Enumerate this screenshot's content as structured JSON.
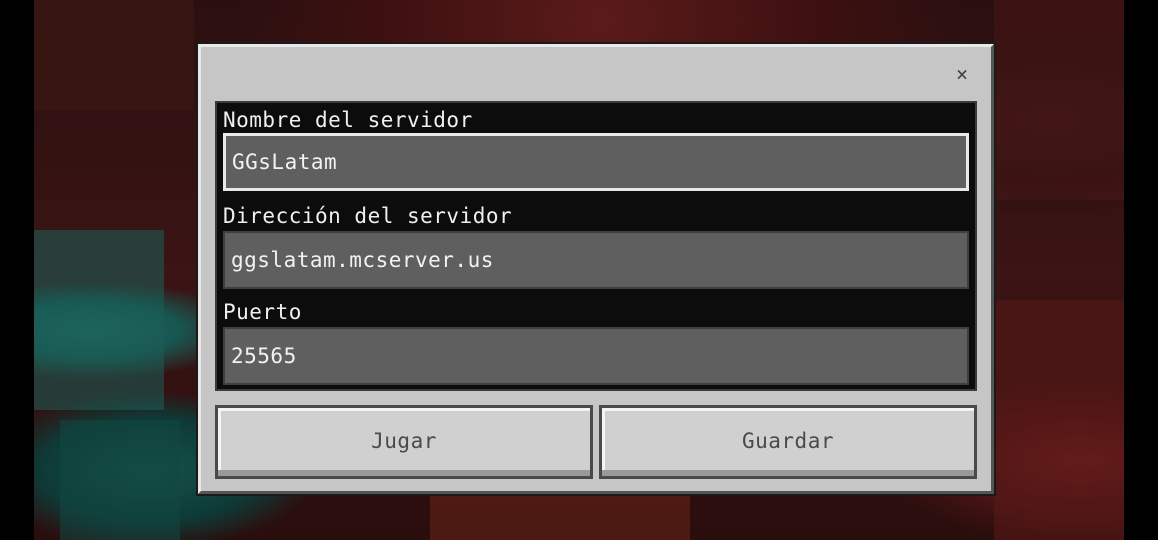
{
  "dialog": {
    "close_glyph": "×",
    "fields": [
      {
        "label": "Nombre del servidor",
        "value": "GGsLatam"
      },
      {
        "label": "Dirección del servidor",
        "value": "ggslatam.mcserver.us"
      },
      {
        "label": "Puerto",
        "value": "25565"
      }
    ],
    "buttons": {
      "play_label": "Jugar",
      "save_label": "Guardar"
    }
  }
}
